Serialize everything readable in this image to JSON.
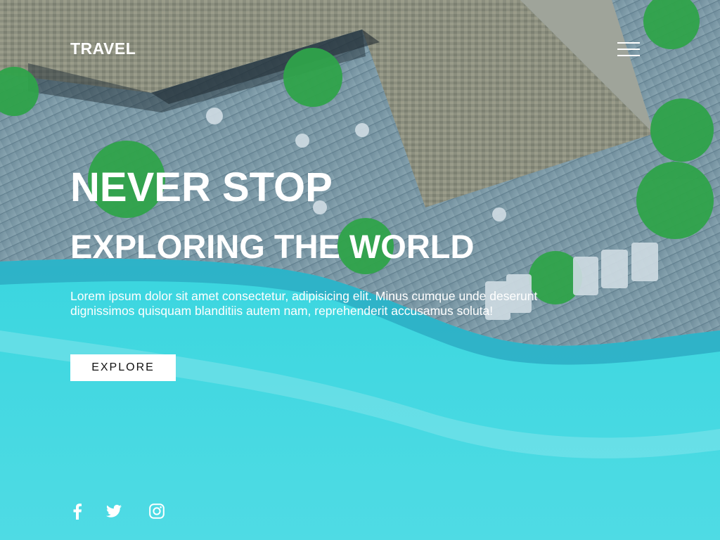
{
  "brand": {
    "logo_text": "TRAVEL"
  },
  "header": {
    "menu_icon": "hamburger-menu-icon"
  },
  "hero": {
    "title_line_1": "NEVER STOP",
    "title_line_2": "EXPLORING THE WORLD",
    "description": "Lorem ipsum dolor sit amet consectetur, adipisicing elit. Minus cumque unde deserunt dignissimos quisquam blanditiis autem nam, reprehenderit accusamus soluta!",
    "cta_label": "EXPLORE"
  },
  "social": [
    {
      "icon": "facebook-icon"
    },
    {
      "icon": "twitter-icon"
    },
    {
      "icon": "instagram-icon"
    }
  ],
  "colors": {
    "text": "#ffffff",
    "button_bg": "#ffffff",
    "button_text": "#111111",
    "water": "#3fd8e1",
    "deck": "#7c98a6",
    "roof": "#8a8f80"
  }
}
